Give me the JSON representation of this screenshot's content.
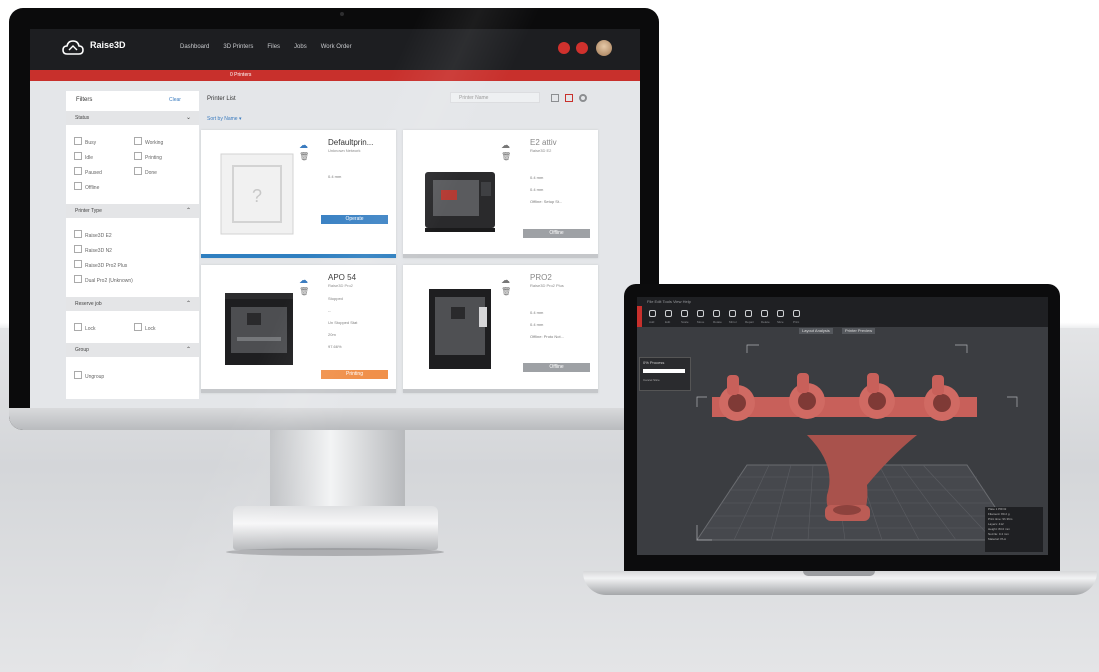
{
  "app": {
    "brand": "Raise3D",
    "nav": [
      "Dashboard",
      "3D Printers",
      "Files",
      "Jobs",
      "Work Order"
    ],
    "alert_bar": "0 Printers"
  },
  "filters": {
    "title": "Filters",
    "clear": "Clear",
    "status": {
      "label": "Status",
      "options": [
        "Busy",
        "Idle",
        "Paused",
        "Offline",
        "Working",
        "Printing",
        "Done"
      ]
    },
    "printer_type": {
      "label": "Printer Type",
      "options": [
        "Raise3D E2",
        "Raise3D N2",
        "Raise3D Pro2 Plus",
        "Dual Pro2 (Unknown)"
      ]
    },
    "reserve_job": {
      "label": "Reserve job",
      "options": [
        "Lock",
        "Lock"
      ]
    },
    "group": {
      "label": "Group",
      "options": [
        "Ungroup"
      ]
    }
  },
  "printer_list": {
    "title": "Printer List",
    "sort": "Sort by Name ▾",
    "search_placeholder": "Printer Name",
    "cards": [
      {
        "name": "Defaultprin...",
        "sub": "Unknown Network",
        "rows": [
          "0.4 mm"
        ],
        "button": "Operate",
        "button_color": "#3b82c4",
        "strip": "#2f7fc0"
      },
      {
        "name": "E2 attiv",
        "sub": "Raise3D E2",
        "rows": [
          "0.4 mm",
          "0.4 mm",
          "Offline: Setup St..."
        ],
        "button": "Offline",
        "button_color": "#9ea1a5",
        "strip": "#c5c7ca"
      },
      {
        "name": "APO 54",
        "sub": "Raise3D Pro2",
        "rows": [
          "Stopped",
          "--",
          "Un Stopped Stat",
          "20m",
          "97.66%"
        ],
        "button": "Printing",
        "button_color": "#f0904a",
        "strip": "#c5c7ca"
      },
      {
        "name": "PRO2",
        "sub": "Raise3D Pro2 Plus",
        "rows": [
          "0.4 mm",
          "0.4 mm",
          "Offline: Proto Not..."
        ],
        "button": "Offline",
        "button_color": "#9ea1a5",
        "strip": "#c5c7ca"
      }
    ]
  },
  "slicer": {
    "menu": "File  Edit  Tools  View  Help",
    "toolbar": [
      "Add",
      "Edit",
      "Scale",
      "Move",
      "Rotate",
      "Mirror",
      "Repair",
      "Delete",
      "Slice",
      "Print"
    ],
    "chips": [
      "Layout Analysis",
      "Printer Preview"
    ],
    "panel_title": "0% Process",
    "panel_button": "Cancel Slice",
    "model_color": "#c8605a",
    "info_lines": [
      "Plate 1  PRO2",
      "Filament: 80.2 g",
      "Print time: 9h 36m",
      "Layers: 412",
      "Height: 83.0 mm",
      "Nozzle: 0.4 mm",
      "Material: PLA"
    ]
  }
}
